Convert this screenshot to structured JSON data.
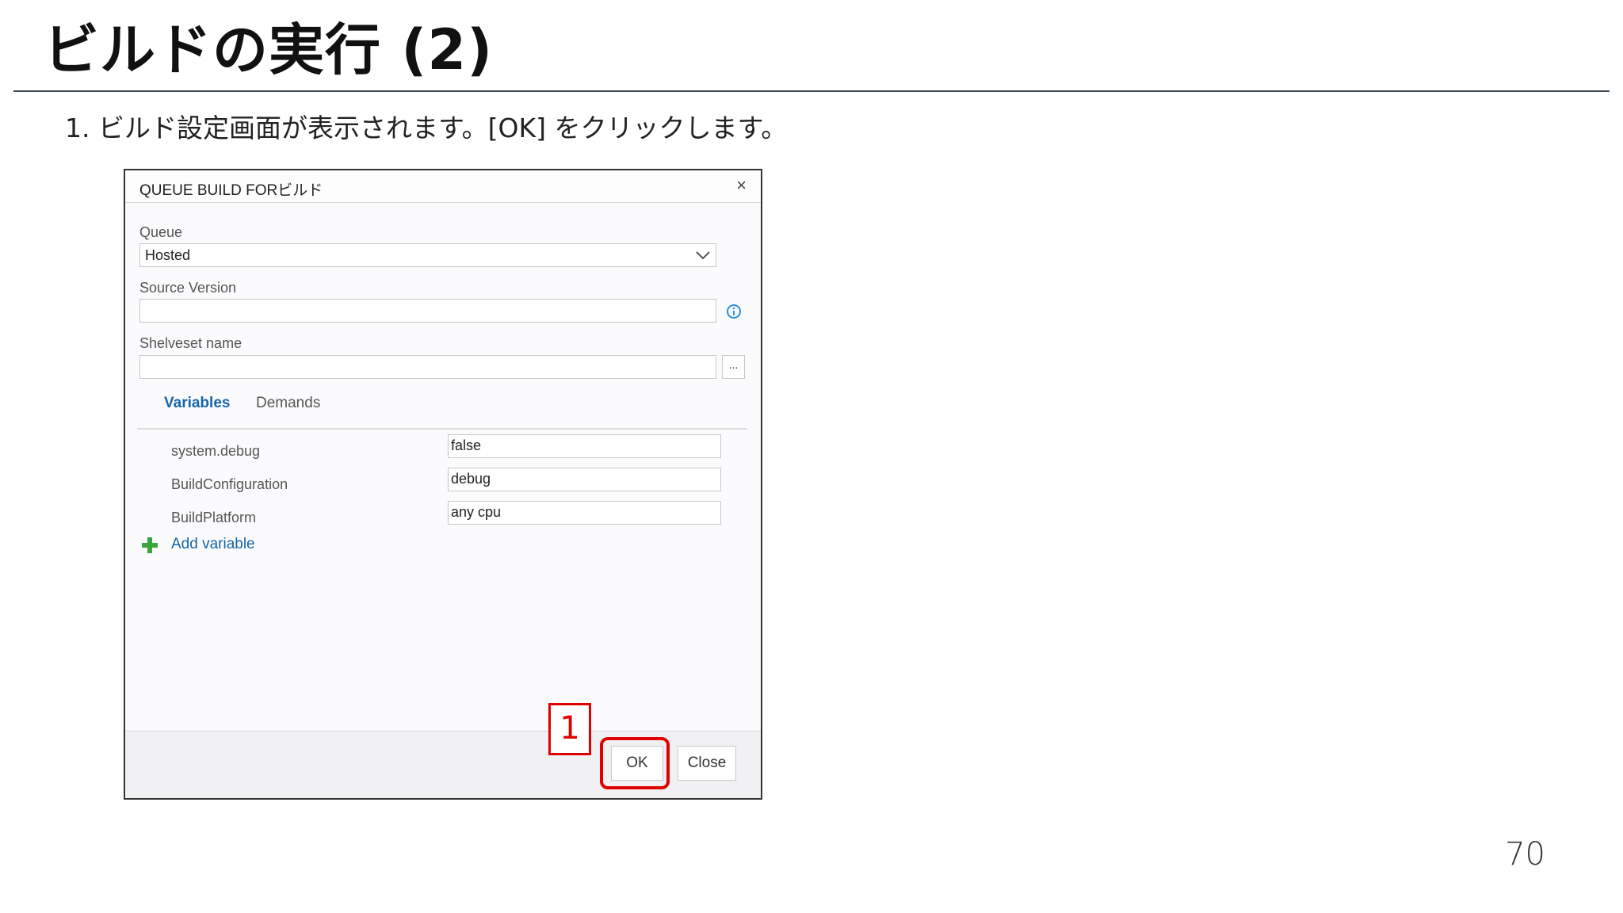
{
  "slide": {
    "title": "ビルドの実行 (2)",
    "step_text": "1.  ビルド設定画面が表示されます。[OK] をクリックします。",
    "page_number": "70"
  },
  "dialog": {
    "title": "QUEUE BUILD FORビルド",
    "close_glyph": "×",
    "queue": {
      "label": "Queue",
      "value": "Hosted"
    },
    "source_version": {
      "label": "Source Version",
      "value": ""
    },
    "shelveset": {
      "label": "Shelveset name",
      "value": "",
      "browse_label": "..."
    },
    "tabs": [
      {
        "label": "Variables",
        "active": true
      },
      {
        "label": "Demands",
        "active": false
      }
    ],
    "variables": [
      {
        "name": "system.debug",
        "value": "false"
      },
      {
        "name": "BuildConfiguration",
        "value": "debug"
      },
      {
        "name": "BuildPlatform",
        "value": "any cpu"
      }
    ],
    "add_variable_label": "Add variable",
    "buttons": {
      "ok": "OK",
      "close": "Close"
    }
  },
  "annotation": {
    "step_number": "1",
    "color": "#e00000"
  },
  "colors": {
    "link": "#1565a8",
    "add_icon": "#3aa53a",
    "info_icon": "#2a8fd6"
  }
}
